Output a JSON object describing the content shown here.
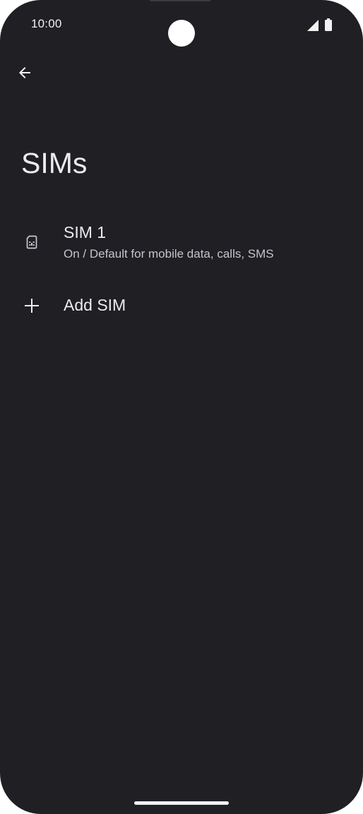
{
  "status_bar": {
    "time": "10:00",
    "icons": [
      "signal-icon",
      "battery-icon"
    ]
  },
  "toolbar": {
    "back_icon": "arrow-back-icon"
  },
  "page": {
    "title": "SIMs"
  },
  "list": {
    "items": [
      {
        "icon": "sim-card-icon",
        "title": "SIM 1",
        "subtitle": "On / Default for mobile data, calls, SMS"
      },
      {
        "icon": "plus-icon",
        "title": "Add SIM"
      }
    ]
  },
  "colors": {
    "background": "#1f1f24",
    "text_primary": "#ecebf0",
    "text_secondary": "#c6c4cc"
  }
}
